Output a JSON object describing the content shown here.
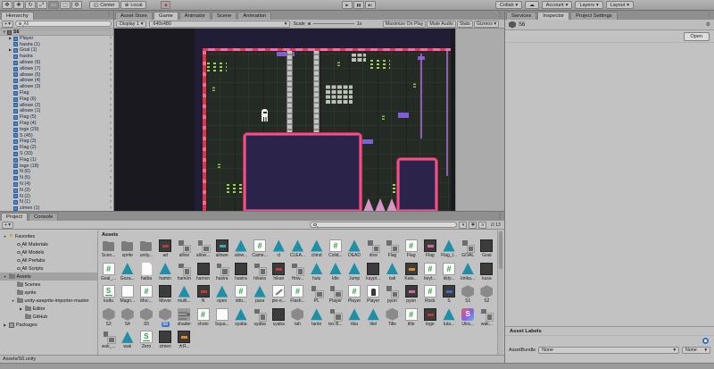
{
  "topbar": {
    "tools": [
      "hand-tool",
      "move-tool",
      "rotate-tool",
      "scale-tool",
      "rect-tool",
      "transform-tool",
      "custom-tool"
    ],
    "active_tool_index": 4,
    "pivot": "Center",
    "space": "Local",
    "collab": "Collab",
    "account": "Account",
    "layers": "Layers",
    "layout": "Layout"
  },
  "hierarchy": {
    "tab": "Hierarchy",
    "create_label": "+",
    "search_placeholder": "All",
    "root": "S6",
    "items": [
      {
        "l": "Player",
        "a": 1
      },
      {
        "l": "hasira (1)"
      },
      {
        "l": "Goal (1)",
        "a": 1
      },
      {
        "l": "hasira"
      },
      {
        "l": "allowe (6)"
      },
      {
        "l": "allowe (7)"
      },
      {
        "l": "allowe (5)"
      },
      {
        "l": "allowe (4)"
      },
      {
        "l": "allowe (3)"
      },
      {
        "l": "Flag"
      },
      {
        "l": "Flag (6)"
      },
      {
        "l": "allowe (2)"
      },
      {
        "l": "allowe (1)"
      },
      {
        "l": "Flag (5)"
      },
      {
        "l": "Flag (4)"
      },
      {
        "l": "toge (29)"
      },
      {
        "l": "S (45)"
      },
      {
        "l": "Flag (3)"
      },
      {
        "l": "Flag (2)"
      },
      {
        "l": "S (33)"
      },
      {
        "l": "Flag (1)"
      },
      {
        "l": "toge (18)"
      },
      {
        "l": "N (6)"
      },
      {
        "l": "N (5)"
      },
      {
        "l": "N (4)"
      },
      {
        "l": "N (3)"
      },
      {
        "l": "N (2)"
      },
      {
        "l": "N (1)"
      },
      {
        "l": "zimen (1)"
      }
    ]
  },
  "game": {
    "tabs": [
      "Asset Store",
      "Game",
      "Animator",
      "Scene",
      "Animation"
    ],
    "active_tab": "Game",
    "display": "Display 1",
    "resolution": "640x480",
    "scale_label": "Scale",
    "scale_value": "1x",
    "buttons": [
      "Maximize On Play",
      "Mute Audio",
      "Stats",
      "Gizmos"
    ]
  },
  "inspector": {
    "tabs": [
      "Services",
      "Inspector",
      "Project Settings"
    ],
    "active_tab": "Inspector",
    "object_name": "S6",
    "open_button": "Open",
    "asset_labels_title": "Asset Labels",
    "assetbundle_label": "AssetBundle",
    "assetbundle_value": "None",
    "assetbundle_variant": "None"
  },
  "project": {
    "tabs": [
      "Project",
      "Console"
    ],
    "active_tab": "Project",
    "create_label": "+",
    "search_placeholder": "",
    "hidden_count": "13",
    "tree": [
      {
        "l": "Favorites",
        "i": "star",
        "d": 0,
        "e": "▼"
      },
      {
        "l": "All Materials",
        "i": "mag",
        "d": 1
      },
      {
        "l": "All Models",
        "i": "mag",
        "d": 1
      },
      {
        "l": "All Prefabs",
        "i": "mag",
        "d": 1
      },
      {
        "l": "All Scripts",
        "i": "mag",
        "d": 1
      },
      {
        "l": "Assets",
        "i": "fold",
        "d": 0,
        "e": "▼",
        "sel": true
      },
      {
        "l": "Scenes",
        "i": "fold",
        "d": 1
      },
      {
        "l": "sprite",
        "i": "fold",
        "d": 1
      },
      {
        "l": "unity-aseprite-importer-master",
        "i": "fold",
        "d": 1,
        "e": "▼"
      },
      {
        "l": "Editor",
        "i": "fold",
        "d": 2,
        "e": "▶"
      },
      {
        "l": "GitHub",
        "i": "fold",
        "d": 2
      },
      {
        "l": "Packages",
        "i": "pkg",
        "d": 0,
        "e": "▶"
      }
    ],
    "grid_header": "Assets",
    "selected_asset": "S6",
    "assets": [
      [
        "Scen...",
        "folder"
      ],
      [
        "sprite",
        "folder"
      ],
      [
        "unity...",
        "folder"
      ],
      [
        "ad",
        "img",
        "#c03a3a"
      ],
      [
        "allow",
        "prefab"
      ],
      [
        "allow...",
        "prefab"
      ],
      [
        "allowe",
        "img",
        "#3aabb5"
      ],
      [
        "alow...",
        "ase"
      ],
      [
        "Came...",
        "script"
      ],
      [
        "cl",
        "ase"
      ],
      [
        "CLEA...",
        "ase"
      ],
      [
        "climd",
        "ase"
      ],
      [
        "Colid...",
        "script"
      ],
      [
        "DEAD",
        "ase"
      ],
      [
        "dow",
        "prefab"
      ],
      [
        "Flag",
        "prefab"
      ],
      [
        "Flag",
        "script"
      ],
      [
        "Flag",
        "img",
        "#d36aa8"
      ],
      [
        "Flag_l...",
        "ase"
      ],
      [
        "GOAL",
        "prefab"
      ],
      [
        "Goal",
        "img"
      ],
      [
        "Goal_...",
        "script"
      ],
      [
        "Goza...",
        "ase"
      ],
      [
        "haiba",
        "doc"
      ],
      [
        "hamin",
        "ase"
      ],
      [
        "hamon",
        "prefab"
      ],
      [
        "hamon",
        "img"
      ],
      [
        "hasira",
        "prefab"
      ],
      [
        "hasira",
        "img"
      ],
      [
        "hikara",
        "prefab"
      ],
      [
        "hikari",
        "img",
        "#c03a3a"
      ],
      [
        "How...",
        "prefab"
      ],
      [
        "hulu",
        "ase"
      ],
      [
        "Idle",
        "ase"
      ],
      [
        "Jump",
        "ase"
      ],
      [
        "kaypt...",
        "img"
      ],
      [
        "kati",
        "ase"
      ],
      [
        "Kata...",
        "img",
        "#e08a20"
      ],
      [
        "keyt...",
        "script"
      ],
      [
        "kkty...",
        "script"
      ],
      [
        "kirika...",
        "ase"
      ],
      [
        "kusa",
        "img"
      ],
      [
        "kuttu",
        "green"
      ],
      [
        "Magn...",
        "white"
      ],
      [
        "Moc...",
        "script"
      ],
      [
        "Mover",
        "img"
      ],
      [
        "multi...",
        "ase"
      ],
      [
        "N",
        "img",
        "#c03a3a"
      ],
      [
        "open",
        "ase"
      ],
      [
        "otto...",
        "script"
      ],
      [
        "para",
        "ase"
      ],
      [
        "pin-e...",
        "picker"
      ],
      [
        "Flash...",
        "script"
      ],
      [
        "PL",
        "prefab"
      ],
      [
        "Player",
        "prefab"
      ],
      [
        "Player",
        "script"
      ],
      [
        "Player",
        "player"
      ],
      [
        "pyon",
        "prefab"
      ],
      [
        "pyon",
        "img",
        "#d36aa8"
      ],
      [
        "Rock",
        "script"
      ],
      [
        "S",
        "img",
        "#4666c8"
      ],
      [
        "S1",
        "scene"
      ],
      [
        "S2",
        "scene"
      ],
      [
        "S3",
        "scene"
      ],
      [
        "S4",
        "scene"
      ],
      [
        "S5",
        "scene"
      ],
      [
        "S6",
        "scene"
      ],
      [
        "shader",
        "shader"
      ],
      [
        "shoto",
        "script"
      ],
      [
        "Squa...",
        "white"
      ],
      [
        "syaba",
        "ase"
      ],
      [
        "syaba",
        "prefab"
      ],
      [
        "syaba",
        "img"
      ],
      [
        "tah",
        "scene"
      ],
      [
        "tanto",
        "ase"
      ],
      [
        "tex B...",
        "prefab"
      ],
      [
        "tika",
        "ase"
      ],
      [
        "titel",
        "ase"
      ],
      [
        "Title",
        "scene"
      ],
      [
        "title",
        "script"
      ],
      [
        "toge",
        "img",
        "#c03a3a"
      ],
      [
        "tuta...",
        "ase"
      ],
      [
        "Utra...",
        "sfile"
      ],
      [
        "wak...",
        "prefab"
      ],
      [
        "wak_...",
        "prefab"
      ],
      [
        "wak",
        "ase"
      ],
      [
        "Zero",
        "green"
      ],
      [
        "zimen",
        "img"
      ],
      [
        "大R...",
        "img",
        "#e08a20"
      ]
    ],
    "breadcrumb": "Assets/S6.unity"
  }
}
